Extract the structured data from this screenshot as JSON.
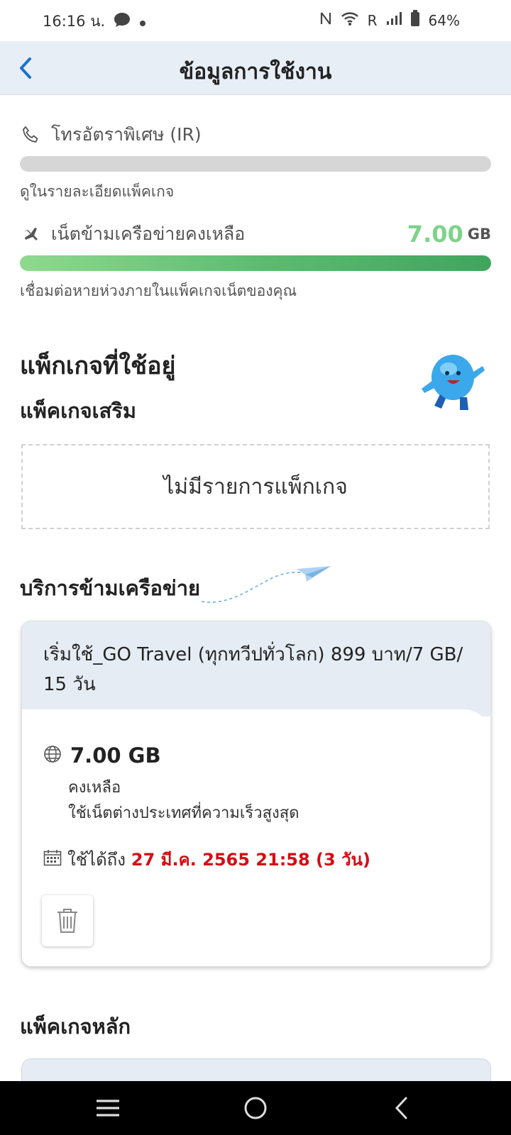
{
  "status_bar": {
    "time": "16:16 น.",
    "battery": "64%",
    "network": "R"
  },
  "header": {
    "title": "ข้อมูลการใช้งาน"
  },
  "usage": {
    "call": {
      "label": "โทรอัตราพิเศษ (IR)",
      "note": "ดูในรายละเอียดแพ็คเกจ"
    },
    "data": {
      "label": "เน็ตข้ามเครือข่ายคงเหลือ",
      "value": "7.00",
      "unit": "GB",
      "fill_fraction": 1.0,
      "note": "เชื่อมต่อหายห่วงภายในแพ็คเกจเน็ตของคุณ"
    }
  },
  "sections": {
    "active_packages": "แพ็กเกจที่ใช้อยู่",
    "addon_packages": "แพ็คเกจเสริม",
    "empty_message": "ไม่มีรายการแพ็กเกจ",
    "roaming": "บริการข้ามเครือข่าย",
    "main_packages": "แพ็คเกจหลัก"
  },
  "roaming_card": {
    "title": "เริ่มใช้_GO Travel (ทุกทวีปทั่วโลก) 899 บาท/7 GB/ 15 วัน",
    "amount": "7.00 GB",
    "remaining_label": "คงเหลือ",
    "speed_label": "ใช้เน็ตต่างประเทศที่ความเร็วสูงสุด",
    "expire_label": "ใช้ได้ถึง",
    "expire_date": "27 มี.ค. 2565 21:58 (3 วัน)"
  },
  "colors": {
    "accent_green": "#7ed38b",
    "expire_red": "#d40e14",
    "header_bg": "#e8eef6",
    "back_blue": "#1a73c8"
  }
}
